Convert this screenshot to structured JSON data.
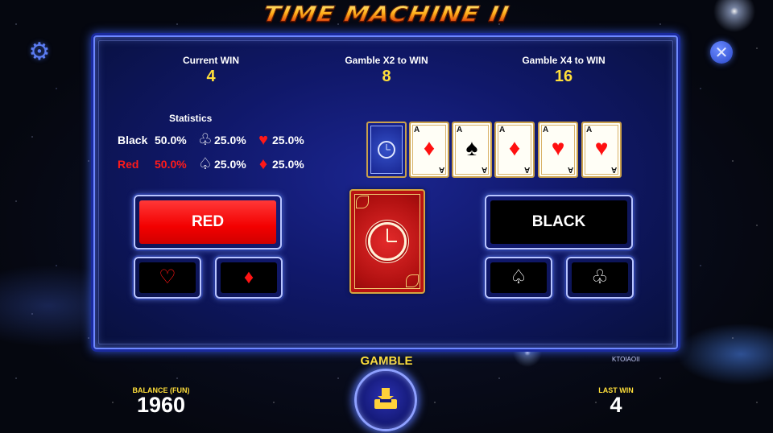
{
  "game": {
    "title": "TIME MACHINE II"
  },
  "controls": {
    "settings_icon": "gear-icon",
    "close_icon": "close-icon"
  },
  "header_stats": [
    {
      "label": "Current WIN",
      "value": "4"
    },
    {
      "label": "Gamble X2 to WIN",
      "value": "8"
    },
    {
      "label": "Gamble X4 to WIN",
      "value": "16"
    }
  ],
  "statistics": {
    "title": "Statistics",
    "rows": [
      {
        "label": "Black",
        "pct": "50.0%",
        "suit1": "♧",
        "suit1_pct": "25.0%",
        "suit2": "♥",
        "suit2_pct": "25.0%"
      },
      {
        "label": "Red",
        "pct": "50.0%",
        "suit1": "♤",
        "suit1_pct": "25.0%",
        "suit2": "♦",
        "suit2_pct": "25.0%"
      }
    ]
  },
  "history": {
    "cards": [
      {
        "rank": "A",
        "suit": "♦",
        "color": "red"
      },
      {
        "rank": "A",
        "suit": "♠",
        "color": "black"
      },
      {
        "rank": "A",
        "suit": "♦",
        "color": "red"
      },
      {
        "rank": "A",
        "suit": "♥",
        "color": "red"
      },
      {
        "rank": "A",
        "suit": "♥",
        "color": "red"
      }
    ]
  },
  "buttons": {
    "red": "RED",
    "black": "BLACK",
    "hearts": "♡",
    "diamonds": "♦",
    "spades": "♤",
    "clubs": "♧"
  },
  "bottom": {
    "gamble_label": "GAMBLE",
    "balance_label": "BALANCE (FUN)",
    "balance": "1960",
    "last_win_label": "LAST WIN",
    "last_win": "4",
    "version": "KTOIAOII"
  },
  "colors": {
    "red_button": "#f30000",
    "gold_text": "#ffdf3a",
    "panel_border": "#6e88ff"
  }
}
